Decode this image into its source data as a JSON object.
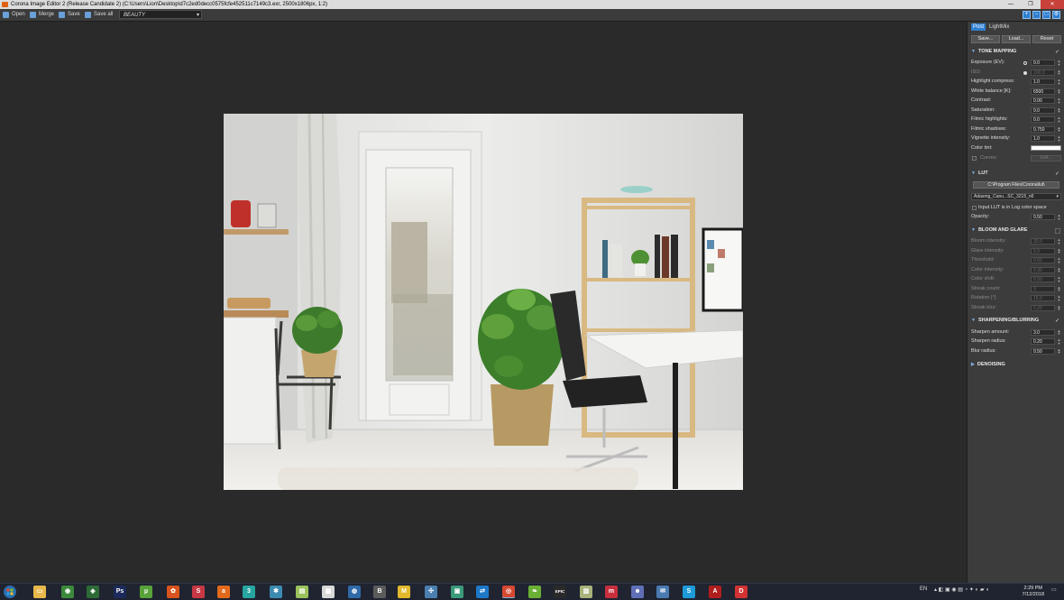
{
  "window": {
    "title": "Corona Image Editor 2 (Release Candidate 2) (C:\\Users\\Lion\\Desktop\\d7c2ed0decc0575fcfe452511c7149c3.exr, 2500x1806px, 1:2)",
    "controls": [
      "—",
      "❐",
      "✕"
    ]
  },
  "toolbar": {
    "open_label": "Open",
    "merge_label": "Merge",
    "save_label": "Save",
    "saveall_label": "Save all",
    "pass_selected": "BEAUTY"
  },
  "tool_icons": [
    "zoom-in-icon",
    "zoom-out-icon",
    "zoom-fit-icon",
    "settings-icon"
  ],
  "panel": {
    "tabs": [
      {
        "label": "Post",
        "active": true
      },
      {
        "label": "LightMix",
        "active": false
      }
    ],
    "buttons": {
      "save": "Save...",
      "load": "Load...",
      "reset": "Reset"
    },
    "tone_mapping": {
      "title": "TONE MAPPING",
      "enabled": true,
      "rows": [
        {
          "label": "Exposure (EV):",
          "value": "0.0",
          "dot": "ring"
        },
        {
          "label": "ISO:",
          "value": "100.0",
          "dot": "filled",
          "disabled": true
        },
        {
          "label": "Highlight compress:",
          "value": "1.0"
        },
        {
          "label": "White balance [K]:",
          "value": "6500"
        },
        {
          "label": "Contrast:",
          "value": "0.00"
        },
        {
          "label": "Saturation:",
          "value": "0.0"
        },
        {
          "label": "Filmic highlights:",
          "value": "0.0"
        },
        {
          "label": "Filmic shadows:",
          "value": "0.750"
        },
        {
          "label": "Vignette intensity:",
          "value": "1.0"
        }
      ],
      "color_tint_label": "Color tint:",
      "color_tint": "#ffffff",
      "curves_label": "Curves:",
      "curves_edit": "Edit..."
    },
    "lut": {
      "title": "LUT",
      "enabled": true,
      "path": "C:\\Program Files\\Corona\\lut\\",
      "selected": "Adasmg_Canu...SC_3215_n6",
      "log_label": "Input LUT is in Log color space",
      "opacity_label": "Opacity:",
      "opacity_value": "0.50"
    },
    "bloom_glare": {
      "title": "BLOOM AND GLARE",
      "enabled": false,
      "rows": [
        {
          "label": "Bloom intensity:",
          "value": "30.0"
        },
        {
          "label": "Glare intensity:",
          "value": "5.0"
        },
        {
          "label": "Threshold:",
          "value": "0.50"
        },
        {
          "label": "Color intensity:",
          "value": "0.30"
        },
        {
          "label": "Color shift:",
          "value": "0.50"
        },
        {
          "label": "Streak count:",
          "value": "3"
        },
        {
          "label": "Rotation [°]:",
          "value": "15.0"
        },
        {
          "label": "Streak blur:",
          "value": "0.20"
        }
      ]
    },
    "sharpening": {
      "title": "SHARPENING/BLURRING",
      "enabled": true,
      "rows": [
        {
          "label": "Sharpen amount:",
          "value": "3.0"
        },
        {
          "label": "Sharpen radius:",
          "value": "0.20"
        },
        {
          "label": "Blur radius:",
          "value": "0.50"
        }
      ]
    },
    "denoising": {
      "title": "DENOISING"
    }
  },
  "taskbar": {
    "apps": [
      {
        "name": "file-explorer-icon",
        "glyph": "▭",
        "color": "#e8b84a"
      },
      {
        "name": "chrome-icon",
        "glyph": "◉",
        "color": "#3b8a3b"
      },
      {
        "name": "app-icon-green",
        "glyph": "◈",
        "color": "#2d6b36"
      },
      {
        "name": "photoshop-icon",
        "glyph": "Ps",
        "color": "#1b2a5a"
      },
      {
        "name": "utorrent-icon",
        "glyph": "µ",
        "color": "#58a23a"
      },
      {
        "name": "app-icon-orange",
        "glyph": "✿",
        "color": "#d9541e"
      },
      {
        "name": "substance-icon",
        "glyph": "S",
        "color": "#c83844"
      },
      {
        "name": "app-icon-a",
        "glyph": "a",
        "color": "#e36a1b"
      },
      {
        "name": "3dsmax-icon",
        "glyph": "3",
        "color": "#27a5a0"
      },
      {
        "name": "app-icon-gear",
        "glyph": "✱",
        "color": "#3d8ab0"
      },
      {
        "name": "app-icon-doc",
        "glyph": "▤",
        "color": "#9bc25a"
      },
      {
        "name": "app-icon-white",
        "glyph": "▦",
        "color": "#d8d8d8"
      },
      {
        "name": "app-icon-blue",
        "glyph": "◍",
        "color": "#2f6aa8"
      },
      {
        "name": "app-icon-b",
        "glyph": "B",
        "color": "#5b5b5b"
      },
      {
        "name": "app-icon-m",
        "glyph": "M",
        "color": "#e3b92c"
      },
      {
        "name": "app-icon-net",
        "glyph": "✣",
        "color": "#4a7fb0"
      },
      {
        "name": "app-icon-box",
        "glyph": "▣",
        "color": "#3a9a7a"
      },
      {
        "name": "teamviewer-icon",
        "glyph": "⇄",
        "color": "#1e78c8"
      },
      {
        "name": "corona-icon",
        "glyph": "◎",
        "color": "#d64830"
      },
      {
        "name": "app-icon-leaf",
        "glyph": "❧",
        "color": "#6ab035"
      },
      {
        "name": "epic-games-icon",
        "glyph": "EPIC",
        "color": "#2a2a2a"
      },
      {
        "name": "app-icon-file",
        "glyph": "▥",
        "color": "#a8b27a"
      },
      {
        "name": "app-icon-m2",
        "glyph": "m",
        "color": "#c82f3d"
      },
      {
        "name": "discord-icon",
        "glyph": "☻",
        "color": "#6070b8"
      },
      {
        "name": "app-icon-mail",
        "glyph": "✉",
        "color": "#4a7ab0"
      },
      {
        "name": "skype-icon",
        "glyph": "S",
        "color": "#1d9ad8"
      },
      {
        "name": "acrobat-icon",
        "glyph": "A",
        "color": "#b01e1e"
      },
      {
        "name": "app-icon-d",
        "glyph": "D",
        "color": "#d23232"
      }
    ],
    "language": "EN",
    "time": "2:29 PM",
    "date": "7/12/2018"
  }
}
